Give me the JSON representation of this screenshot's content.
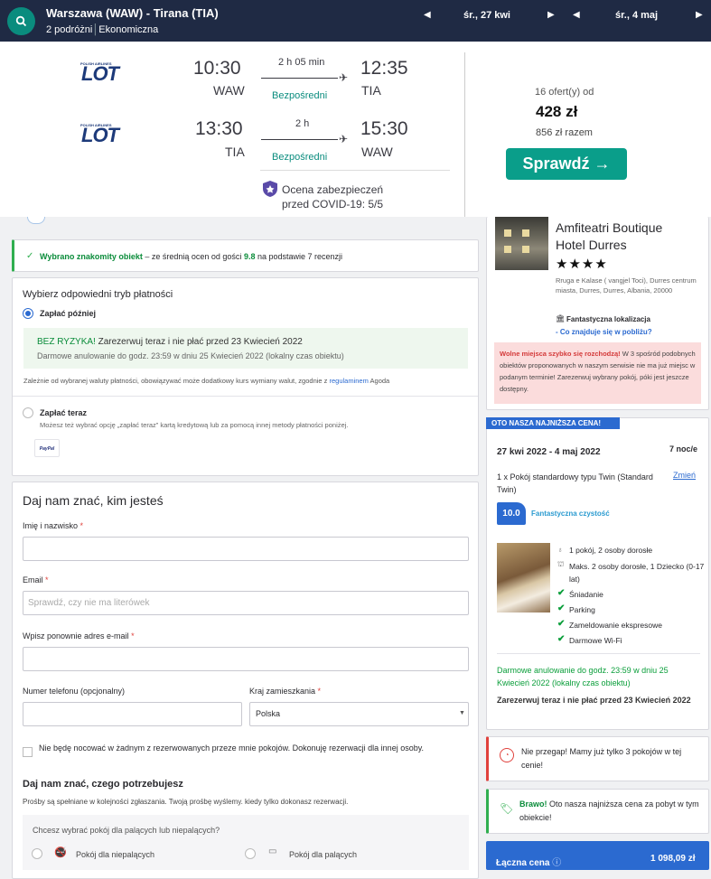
{
  "header": {
    "route": "Warszawa (WAW) - Tirana (TIA)",
    "passengers": "2 podróżni",
    "cabin": "Ekonomiczna",
    "depart_date": "śr., 27 kwi",
    "return_date": "śr., 4 maj"
  },
  "flights": [
    {
      "airline": "LOT",
      "airline_sub": "POLISH AIRLINES",
      "dep_time": "10:30",
      "dep_code": "WAW",
      "duration": "2 h 05 min",
      "stops": "Bezpośredni",
      "arr_time": "12:35",
      "arr_code": "TIA"
    },
    {
      "airline": "LOT",
      "airline_sub": "POLISH AIRLINES",
      "dep_time": "13:30",
      "dep_code": "TIA",
      "duration": "2 h",
      "stops": "Bezpośredni",
      "arr_time": "15:30",
      "arr_code": "WAW"
    }
  ],
  "covid": {
    "line1": "Ocena zabezpieczeń",
    "line2": "przed COVID-19: 5/5"
  },
  "offer": {
    "count": "16 ofert(y) od",
    "price": "428 zł",
    "total": "856 zł razem",
    "cta": "Sprawdź →"
  },
  "banner": {
    "bold": "Wybrano znakomity obiekt",
    "rest": " – ze średnią ocen od gości ",
    "score": "9.8",
    "tail": " na podstawie 7 recenzji"
  },
  "payment": {
    "title": "Wybierz odpowiedni tryb płatności",
    "later_label": "Zapłać później",
    "norisk_bold": "BEZ RYZYKA!",
    "norisk_text": " Zarezerwuj teraz i nie płać przed 23 Kwiecień 2022",
    "cancel_text": "Darmowe anulowanie do godz. 23:59 w dniu 25 Kwiecień 2022 (lokalny czas obiektu)",
    "fx_note": "Zależnie od wybranej waluty płatności, obowiązywać może dodatkowy kurs wymiany walut, zgodnie z ",
    "fx_link": "regulaminem",
    "fx_tail": " Agoda",
    "now_label": "Zapłać teraz",
    "now_sub": "Możesz też wybrać opcję „zapłać teraz” kartą kredytową lub za pomocą innej metody płatności poniżej.",
    "paypal": "PayPal"
  },
  "form": {
    "title": "Daj nam znać, kim jesteś",
    "name_label": "Imię i nazwisko",
    "email_label": "Email",
    "email_placeholder": "Sprawdź, czy nie ma literówek",
    "email2_label": "Wpisz ponownie adres e-mail",
    "phone_label": "Numer telefonu (opcjonalny)",
    "country_label": "Kraj zamieszkania",
    "country_value": "Polska",
    "req": "*",
    "notstay_text": "Nie będę nocować w żadnym z rezerwowanych przeze mnie pokojów. Dokonuję rezerwacji dla innej osoby.",
    "needs_title": "Daj nam znać, czego potrzebujesz",
    "needs_sub": "Prośby są spełniane w kolejności zgłaszania. Twoją prośbę wyślemy. kiedy tylko dokonasz rezerwacji.",
    "smoke_q": "Chcesz wybrać pokój dla palących lub niepalących?",
    "nonsmoke": "Pokój dla niepalących",
    "smoke": "Pokój dla palących"
  },
  "hotel": {
    "name1": "Amfiteatri Boutique",
    "name2": "Hotel Durres",
    "stars": "★★★★",
    "address": "Rruga e Kalase ( vangjel Toci), Durres centrum miasta, Durres, Durres, Albania, 20000",
    "location": "Fantastyczna lokalizacja",
    "nearby": "- Co znajduje się w pobliżu?",
    "urgent_bold": "Wolne miejsca szybko się rozchodzą!",
    "urgent_text": " W 3 spośród podobnych obiektów proponowanych w naszym serwisie nie ma już miejsc w podanym terminie! Zarezerwuj wybrany pokój, póki jest jeszcze dostępny."
  },
  "summary": {
    "badge": "OTO NASZA NAJNIŻSZA CENA!",
    "dates": "27 kwi 2022 - 4 maj 2022",
    "nights": "7 noc/e",
    "room": "1 x Pokój standardowy typu Twin (Standard Twin)",
    "change": "Zmień",
    "score": "10.0",
    "score_label": "Fantastyczna czystość",
    "features": [
      "1 pokój, 2 osoby dorosłe",
      "Maks. 2 osoby dorosłe, 1 Dziecko (0-17 lat)",
      "Śniadanie",
      "Parking",
      "Zameldowanie ekspresowe",
      "Darmowe Wi-Fi"
    ],
    "free_cancel": "Darmowe anulowanie do godz. 23:59 w dniu 25 Kwiecień 2022 (lokalny czas obiektu)",
    "pay_later": "Zarezerwuj teraz i nie płać przed 23 Kwiecień 2022"
  },
  "alerts": {
    "rooms_left": "Nie przegap! Mamy już tylko 3 pokojów w tej cenie!",
    "bravo_bold": "Brawo!",
    "bravo_text": " Oto nasza najniższa cena za pobyt w tym obiekcie!"
  },
  "total": {
    "label": "Łączna cena",
    "info": "ⓘ",
    "value": "1 098,09 zł"
  },
  "colors": {
    "navy": "#1f2a44",
    "teal": "#0a9e8a",
    "green": "#0a8c3a",
    "blue": "#2b6ad0"
  }
}
